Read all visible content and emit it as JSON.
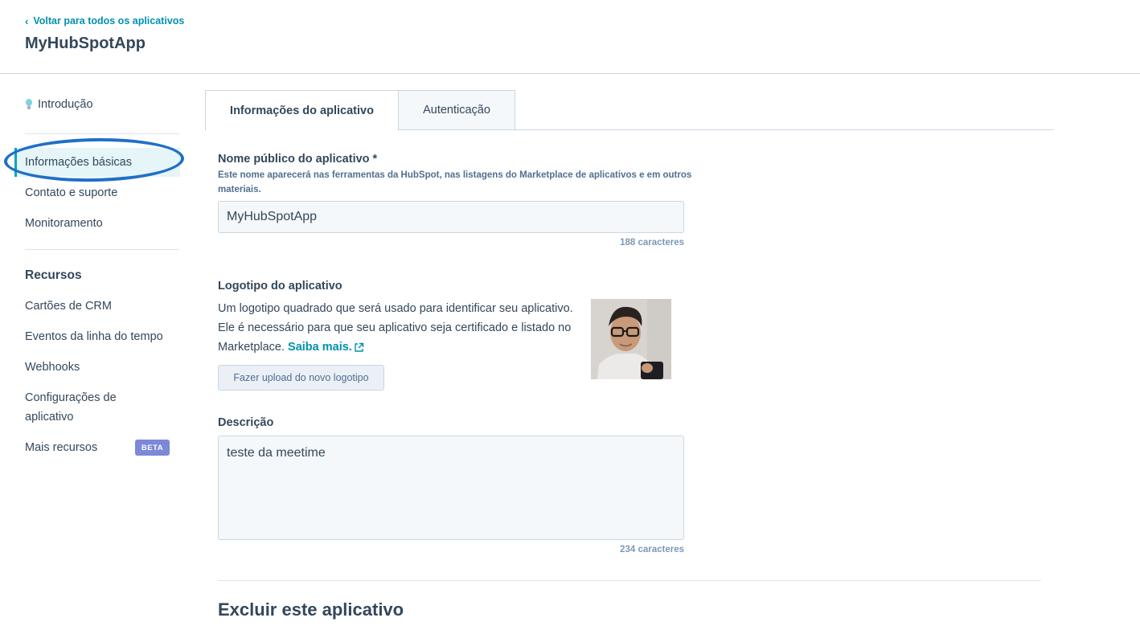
{
  "header": {
    "back_link": "Voltar para todos os aplicativos",
    "app_title": "MyHubSpotApp"
  },
  "sidebar": {
    "intro": "Introdução",
    "items": [
      {
        "label": "Informações básicas",
        "active": true
      },
      {
        "label": "Contato e suporte"
      },
      {
        "label": "Monitoramento"
      }
    ],
    "resources_heading": "Recursos",
    "resources": [
      {
        "label": "Cartões de CRM"
      },
      {
        "label": "Eventos da linha do tempo"
      },
      {
        "label": "Webhooks"
      },
      {
        "label": "Configurações de aplicativo"
      },
      {
        "label": "Mais recursos",
        "badge": "BETA"
      }
    ]
  },
  "tabs": [
    {
      "label": "Informações do aplicativo",
      "active": true
    },
    {
      "label": "Autenticação",
      "active": false
    }
  ],
  "form": {
    "name": {
      "label": "Nome público do aplicativo *",
      "help": "Este nome aparecerá nas ferramentas da HubSpot, nas listagens do Marketplace de aplicativos e em outros materiais.",
      "value": "MyHubSpotApp",
      "counter": "188 caracteres"
    },
    "logo": {
      "label": "Logotipo do aplicativo",
      "description": "Um logotipo quadrado que será usado para identificar seu aplicativo. Ele é necessário para que seu aplicativo seja certificado e listado no Marketplace.",
      "learn_more": "Saiba mais.",
      "upload_button": "Fazer upload do novo logotipo"
    },
    "description": {
      "label": "Descrição",
      "value": "teste da meetime",
      "counter": "234 caracteres"
    }
  },
  "delete_section": {
    "title": "Excluir este aplicativo"
  },
  "colors": {
    "accent": "#0091ae",
    "text": "#33475b",
    "annotation_ring": "#1f6fc8",
    "beta_badge": "#7c88d8"
  }
}
